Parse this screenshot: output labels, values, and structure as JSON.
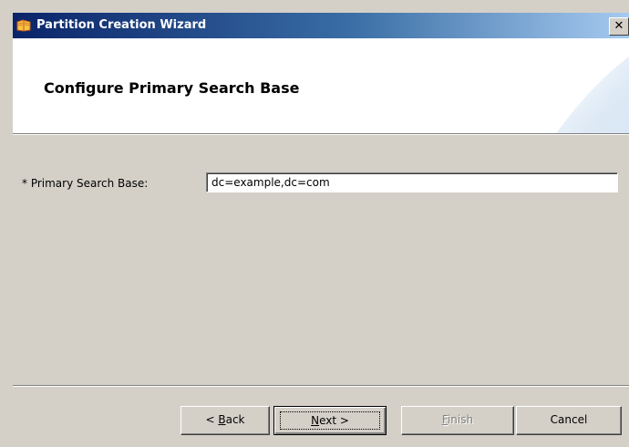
{
  "window": {
    "title": "Partition Creation Wizard",
    "close_glyph": "✕"
  },
  "header": {
    "title": "Configure Primary Search Base"
  },
  "form": {
    "primary_search_base": {
      "label": "* Primary Search Base:",
      "value": "dc=example,dc=com"
    }
  },
  "buttons": {
    "back": {
      "before": "< ",
      "mnemonic": "B",
      "after": "ack"
    },
    "next": {
      "before": "",
      "mnemonic": "N",
      "after": "ext >"
    },
    "finish": {
      "before": "",
      "mnemonic": "F",
      "after": "inish",
      "enabled": false
    },
    "cancel": {
      "label": "Cancel"
    }
  },
  "colors": {
    "titlebar_start": "#0a246a",
    "titlebar_end": "#a6caf0",
    "dialog_face": "#d4d0c8"
  },
  "icons": {
    "app": "wizard-app-icon",
    "close": "close-icon"
  }
}
